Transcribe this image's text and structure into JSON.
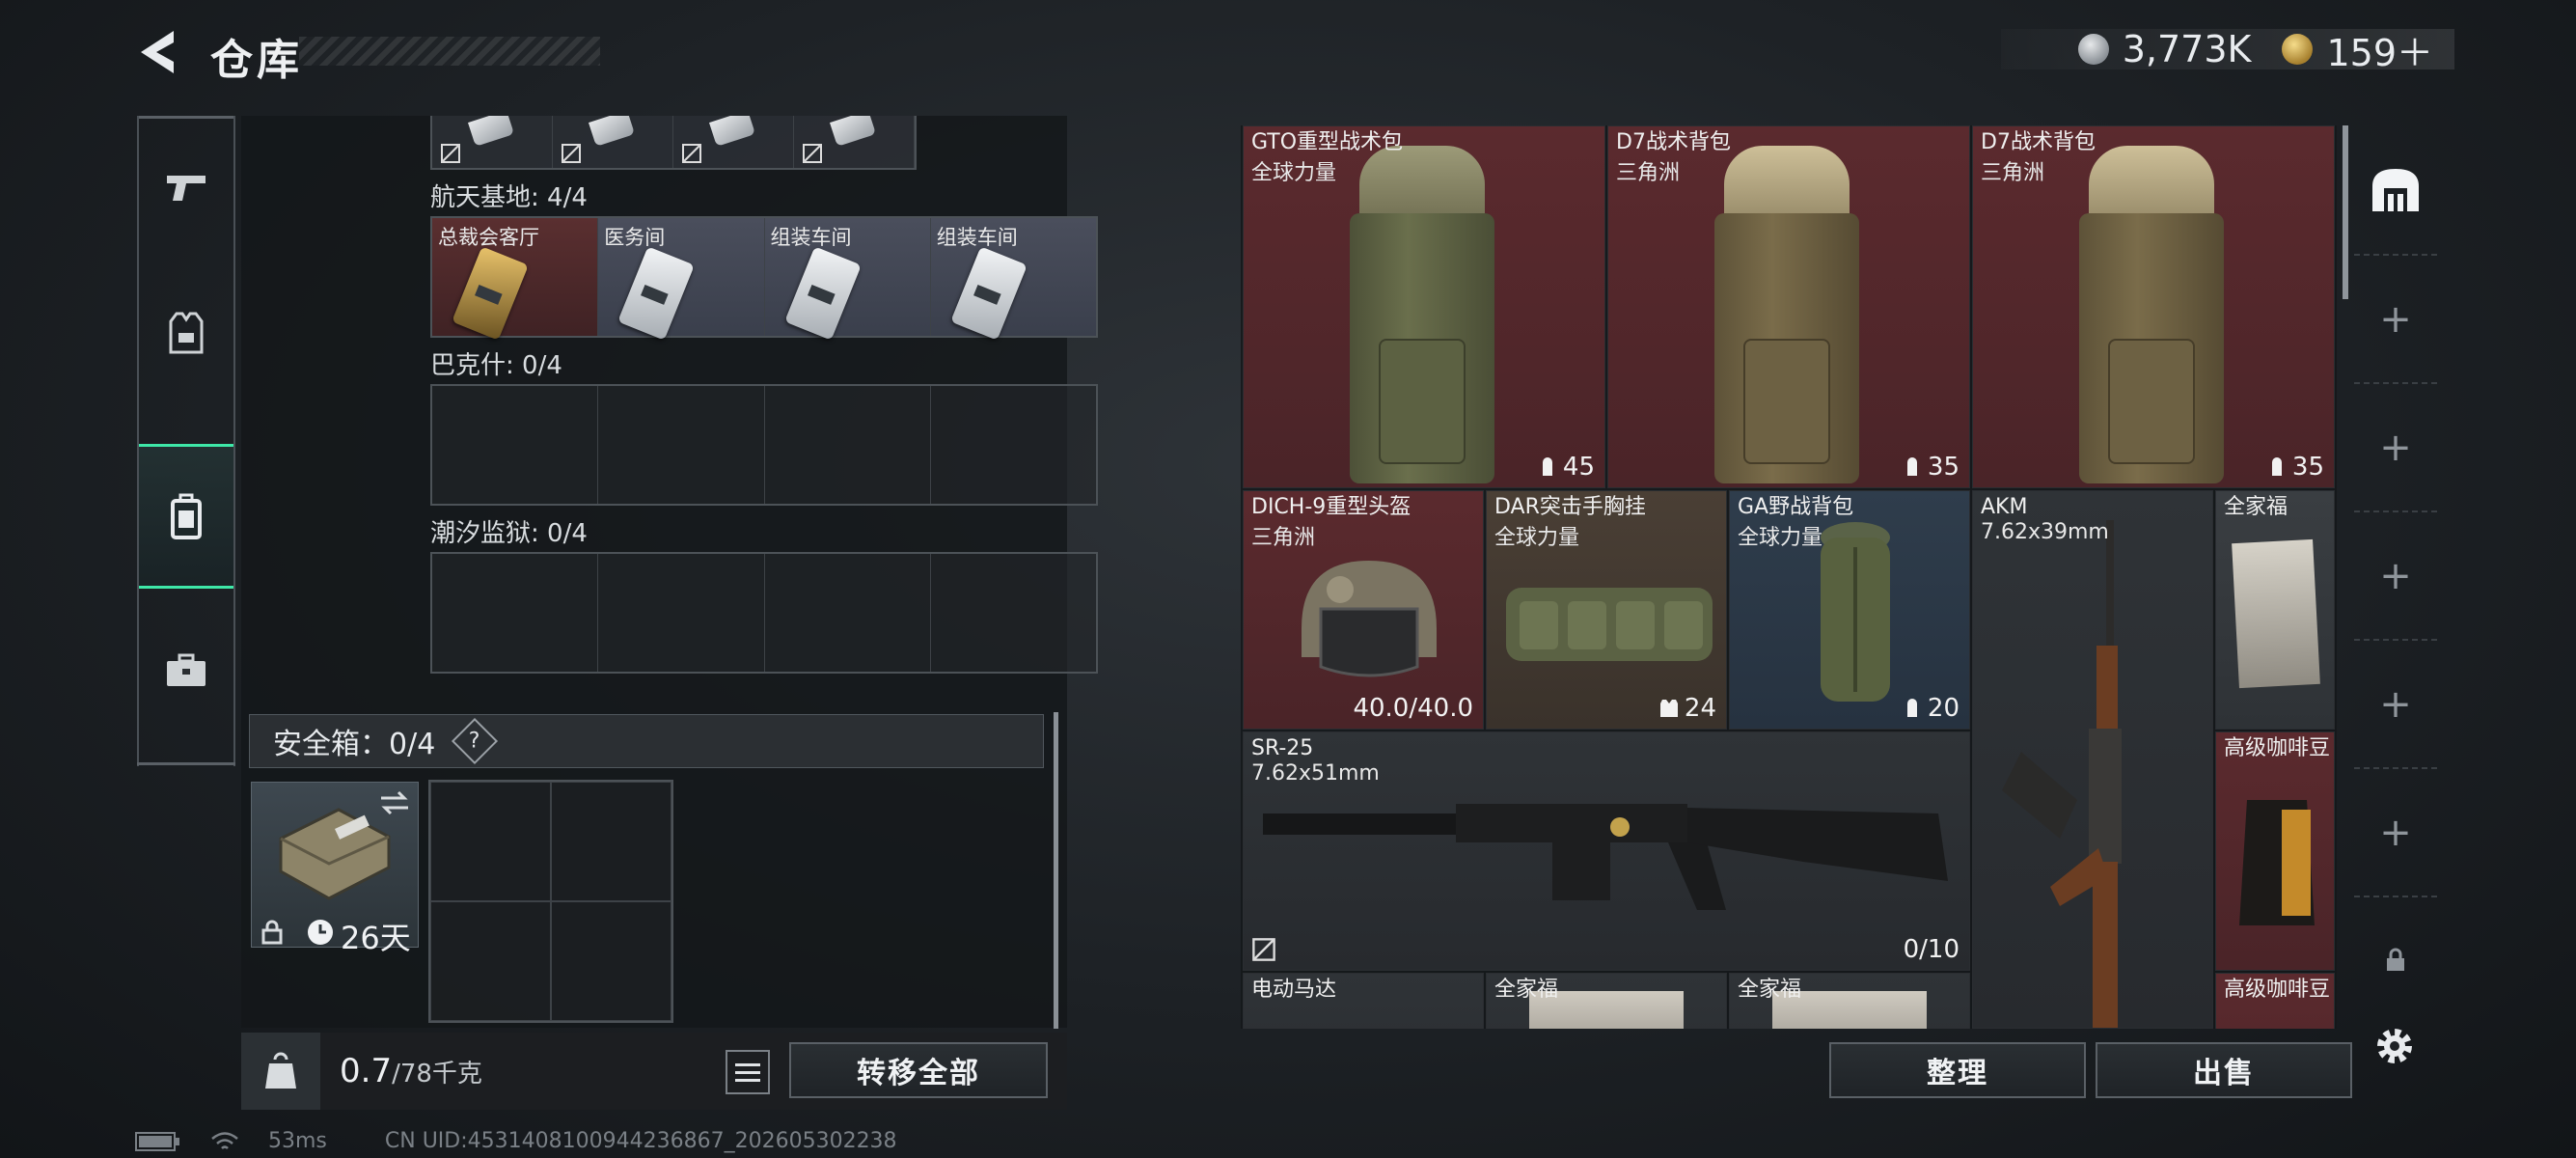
{
  "header": {
    "title": "仓库",
    "currency": [
      {
        "icon": "silver-coin-icon",
        "value": "3,773K"
      },
      {
        "icon": "gold-coin-icon",
        "value": "159＋"
      }
    ]
  },
  "nav": {
    "items": [
      {
        "name": "nav-weapons",
        "icon": "pistol-icon"
      },
      {
        "name": "nav-armor",
        "icon": "vest-icon"
      },
      {
        "name": "nav-container",
        "icon": "case-icon",
        "active": true
      },
      {
        "name": "nav-toolbox",
        "icon": "toolbox-icon"
      }
    ]
  },
  "keycards": {
    "sections": [
      {
        "label": "航天基地: 4/4",
        "cards": [
          {
            "label": "总裁会客厅",
            "style": "gold"
          },
          {
            "label": "医务间",
            "style": "silver"
          },
          {
            "label": "组装车间",
            "style": "silver"
          },
          {
            "label": "组装车间",
            "style": "silver"
          }
        ]
      },
      {
        "label": "巴克什: 0/4",
        "cards": []
      },
      {
        "label": "潮汐监狱: 0/4",
        "cards": []
      }
    ]
  },
  "safe": {
    "title": "安全箱：0/4",
    "help": "?",
    "days": "26天"
  },
  "footer": {
    "weight_value": "0.7",
    "weight_max": "/78千克",
    "transfer_all": "转移全部"
  },
  "inventory": {
    "items": [
      {
        "name": "GTO重型战术包",
        "sub": "全球力量",
        "value": "45",
        "style": "red"
      },
      {
        "name": "D7战术背包",
        "sub": "三角洲",
        "value": "35",
        "style": "red"
      },
      {
        "name": "D7战术背包",
        "sub": "三角洲",
        "value": "35",
        "style": "red"
      },
      {
        "name": "DICH-9重型头盔",
        "sub": "三角洲",
        "value": "40.0/40.0",
        "style": "red"
      },
      {
        "name": "DAR突击手胸挂",
        "sub": "全球力量",
        "value": "24",
        "style": "brown"
      },
      {
        "name": "GA野战背包",
        "sub": "全球力量",
        "value": "20",
        "style": "blue"
      },
      {
        "name": "AKM",
        "sub": "7.62x39mm",
        "value": "",
        "style": "dark"
      },
      {
        "name": "全家福",
        "sub": "",
        "value": "",
        "style": "grey"
      },
      {
        "name": "SR-25",
        "sub": "7.62x51mm",
        "value": "0/10",
        "style": "dark"
      },
      {
        "name": "高级咖啡豆",
        "sub": "",
        "value": "",
        "style": "red"
      },
      {
        "name": "电动马达",
        "sub": "",
        "value": "",
        "style": "dark"
      },
      {
        "name": "全家福",
        "sub": "",
        "value": "",
        "style": "dark"
      },
      {
        "name": "全家福",
        "sub": "",
        "value": "",
        "style": "dark"
      },
      {
        "name": "高级咖啡豆",
        "sub": "",
        "value": "",
        "style": "red"
      }
    ]
  },
  "actions": {
    "organize": "整理",
    "sell": "出售"
  },
  "status": {
    "ping": "53ms",
    "uid": "CN UID:4531408100944236867_202605302238"
  }
}
